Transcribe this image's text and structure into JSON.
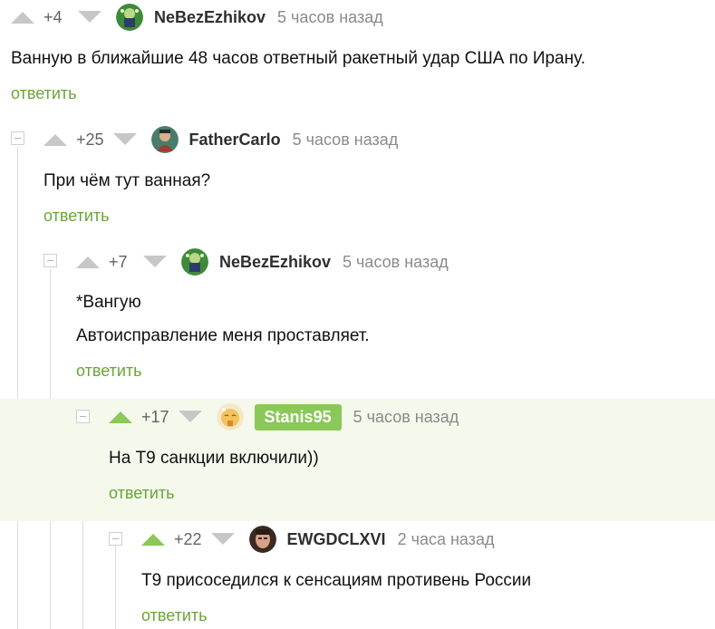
{
  "comments": [
    {
      "rating": "+4",
      "author": "NeBezEzhikov",
      "time": "5 часов назад",
      "lines": [
        "Ванную в ближайшие 48 часов ответный ракетный удар США по Ирану."
      ],
      "reply": "ответить",
      "avatar_icon": "avatar-green-landscape-icon"
    },
    {
      "rating": "+25",
      "author": "FatherCarlo",
      "time": "5 часов назад",
      "lines": [
        "При чём тут ванная?"
      ],
      "reply": "ответить",
      "avatar_icon": "avatar-figure-icon"
    },
    {
      "rating": "+7",
      "author": "NeBezEzhikov",
      "time": "5 часов назад",
      "lines": [
        "*Вангую",
        "Автоисправление меня проставляет."
      ],
      "reply": "ответить",
      "avatar_icon": "avatar-green-landscape-icon"
    },
    {
      "rating": "+17",
      "author": "Stanis95",
      "time": "5 часов назад",
      "lines": [
        "На Т9 санкции включили))"
      ],
      "reply": "ответить",
      "avatar_icon": "avatar-emoji-icon",
      "highlighted": true
    },
    {
      "rating": "+22",
      "author": "EWGDCLXVI",
      "time": "2 часа назад",
      "lines": [
        "Т9 присоседился к сенсациям противень России"
      ],
      "reply": "ответить",
      "avatar_icon": "avatar-portrait-icon"
    }
  ],
  "colors": {
    "vote_inactive": "#c7c7c7",
    "vote_active": "#8ac858",
    "link_green": "#6aa538",
    "highlight_bg": "#f4f9ec"
  }
}
